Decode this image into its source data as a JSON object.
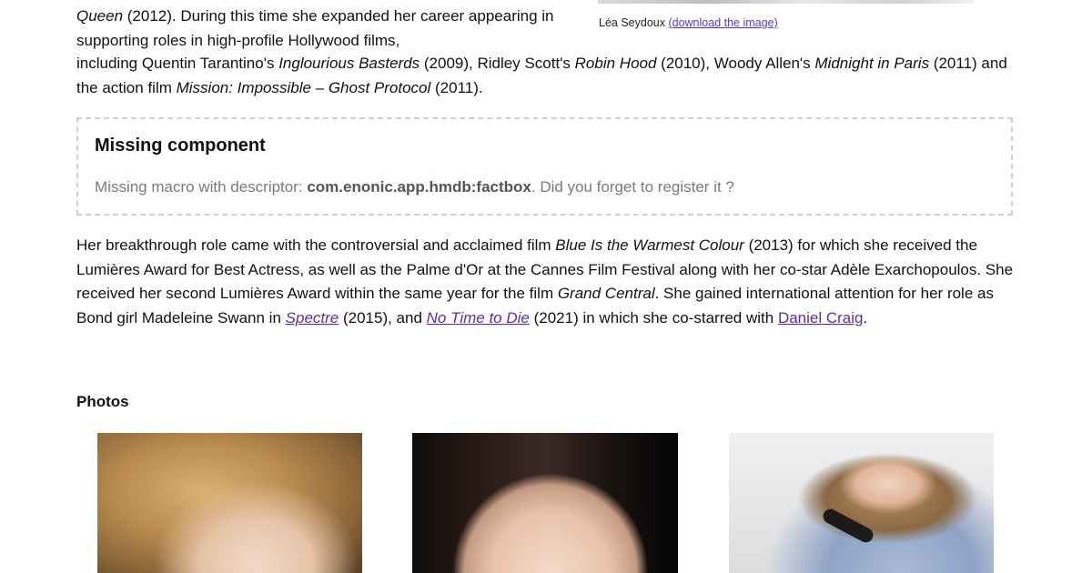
{
  "bio": {
    "p1_top": [
      {
        "t": "Queen",
        "i": true
      },
      {
        "t": " (2012). During this time she expanded her career appearing in supporting roles in high-profile Hollywood films,"
      }
    ],
    "p1_rest": [
      {
        "t": "including Quentin Tarantino's "
      },
      {
        "t": "Inglourious Basterds",
        "i": true
      },
      {
        "t": " (2009), Ridley Scott's "
      },
      {
        "t": "Robin Hood",
        "i": true
      },
      {
        "t": " (2010), Woody Allen's "
      },
      {
        "t": "Midnight in Paris",
        "i": true
      },
      {
        "t": " (2011) and the action film "
      },
      {
        "t": "Mission: Impossible – Ghost Protocol",
        "i": true
      },
      {
        "t": " (2011)."
      }
    ],
    "p2": [
      {
        "t": "Her breakthrough role came with the controversial and acclaimed film "
      },
      {
        "t": "Blue Is the Warmest Colour",
        "i": true
      },
      {
        "t": " (2013) for which she received the Lumières Award for Best Actress, as well as the Palme d'Or at the Cannes Film Festival along with her co-star Adèle Exarchopoulos. She received her second Lumières Award within the same year for the film "
      },
      {
        "t": "Grand Central",
        "i": true
      },
      {
        "t": ". She gained international attention for her role as Bond girl Madeleine Swann in "
      },
      {
        "t": "Spectre",
        "i": true,
        "link": true
      },
      {
        "t": " (2015), and "
      },
      {
        "t": "No Time to Die",
        "i": true,
        "link": true
      },
      {
        "t": " (2021) in which she co-starred with "
      },
      {
        "t": "Daniel Craig",
        "link": true
      },
      {
        "t": "."
      }
    ]
  },
  "image_caption": {
    "name": "Léa Seydoux",
    "link": "(download the image)"
  },
  "missing_component": {
    "title": "Missing component",
    "prefix": "Missing macro with descriptor: ",
    "descriptor": "com.enonic.app.hmdb:factbox",
    "suffix": ". Did you forget to register it ?"
  },
  "photos": {
    "heading": "Photos"
  }
}
